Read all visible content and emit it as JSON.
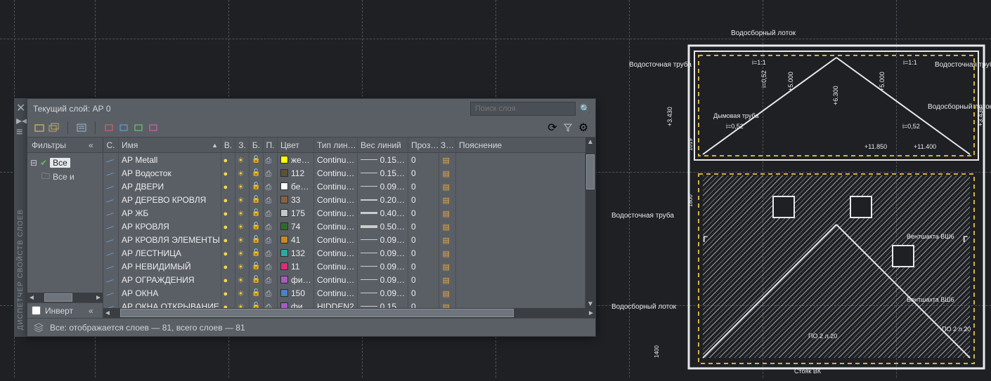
{
  "panel": {
    "title": "Текущий слой: АР 0",
    "search_placeholder": "Поиск слоя",
    "vertical_label": "ДИСПЕТЧЕР СВОЙСТВ СЛОЕВ",
    "footer": "Все: отображается слоев — 81, всего слоев — 81"
  },
  "filters": {
    "header": "Фильтры",
    "tree": [
      {
        "label": "Все",
        "selected": true
      },
      {
        "label": "Все и",
        "child": true
      }
    ],
    "invert_label": "Инверт"
  },
  "columns": {
    "status": "С.",
    "name": "Имя",
    "on": "В.",
    "freeze": "З.",
    "lock": "Б.",
    "plot": "П.",
    "color": "Цвет",
    "ltype": "Тип лин…",
    "lweight": "Вес линий",
    "trans": "Проз…",
    "nps": "З…",
    "desc": "Пояснение"
  },
  "layers": [
    {
      "name": "АР Metall",
      "color_hex": "#ffff00",
      "color_label": "же…",
      "ltype": "Continu…",
      "lw": "0.15…",
      "lw_cls": "th1",
      "trans": "0"
    },
    {
      "name": "АР Водосток",
      "color_hex": "#5b5333",
      "color_label": "112",
      "ltype": "Continu…",
      "lw": "0.15…",
      "lw_cls": "th1",
      "trans": "0"
    },
    {
      "name": "АР ДВЕРИ",
      "color_hex": "#ffffff",
      "color_label": "бе…",
      "ltype": "Continu…",
      "lw": "0.09…",
      "lw_cls": "th1",
      "trans": "0"
    },
    {
      "name": "АР ДЕРЕВО КРОВЛЯ",
      "color_hex": "#86633f",
      "color_label": "33",
      "ltype": "Continu…",
      "lw": "0.20…",
      "lw_cls": "th2",
      "trans": "0"
    },
    {
      "name": "АР ЖБ",
      "color_hex": "#c3c7cb",
      "color_label": "175",
      "ltype": "Continu…",
      "lw": "0.40…",
      "lw_cls": "th3",
      "trans": "0"
    },
    {
      "name": "АР КРОВЛЯ",
      "color_hex": "#2e6b2a",
      "color_label": "74",
      "ltype": "Continu…",
      "lw": "0.50…",
      "lw_cls": "th4",
      "trans": "0"
    },
    {
      "name": "АР КРОВЛЯ ЭЛЕМЕНТЫ",
      "color_hex": "#c78a26",
      "color_label": "41",
      "ltype": "Continu…",
      "lw": "0.09…",
      "lw_cls": "th1",
      "trans": "0"
    },
    {
      "name": "АР ЛЕСТНИЦА",
      "color_hex": "#2da9a3",
      "color_label": "132",
      "ltype": "Continu…",
      "lw": "0.09…",
      "lw_cls": "th1",
      "trans": "0"
    },
    {
      "name": "АР НЕВИДИМЫЙ",
      "color_hex": "#e02a7b",
      "color_label": "11",
      "ltype": "Continu…",
      "lw": "0.09…",
      "lw_cls": "th1",
      "trans": "0"
    },
    {
      "name": "АР ОГРАЖДЕНИЯ",
      "color_hex": "#a85cbf",
      "color_label": "фи…",
      "ltype": "Continu…",
      "lw": "0.09…",
      "lw_cls": "th1",
      "trans": "0"
    },
    {
      "name": "АР ОКНА",
      "color_hex": "#4a82c5",
      "color_label": "150",
      "ltype": "Continu…",
      "lw": "0.09…",
      "lw_cls": "th1",
      "trans": "0"
    },
    {
      "name": "АР ОКНА ОТКРЫВАНИЕ",
      "color_hex": "#a85cbf",
      "color_label": "фи…",
      "ltype": "HIDDEN2",
      "lw": "0.15…",
      "lw_cls": "th1",
      "trans": "0"
    }
  ],
  "drawing_labels": {
    "l1": "Водосборный лоток",
    "l2": "Водосточная труба",
    "l3": "Водосточная труба",
    "l4": "Водосборный лоток",
    "l5": "Водосточная труба",
    "l6": "Водосборный лоток",
    "l7": "Дымовая труба",
    "l8": "Вентшахта ВШ6",
    "l9": "Вентшахта ВШ6",
    "l10": "Стояк ВК",
    "d1": "+3.430",
    "d2": "+3.430",
    "d3": "+5.000",
    "d4": "+5.000",
    "d5": "+6.300",
    "d6": "+11.850",
    "d7": "+11.400",
    "s1": "i=0,52",
    "s2": "i=0,52",
    "s3": "i=0,52",
    "s4": "i=1:1",
    "s5": "i=1:1",
    "g1": "Г",
    "g2": "Г",
    "m1": "1019",
    "m2": "1800",
    "m3": "1400",
    "p1": "ПО 2 л.20",
    "p2": "ПО 2 л.20"
  }
}
